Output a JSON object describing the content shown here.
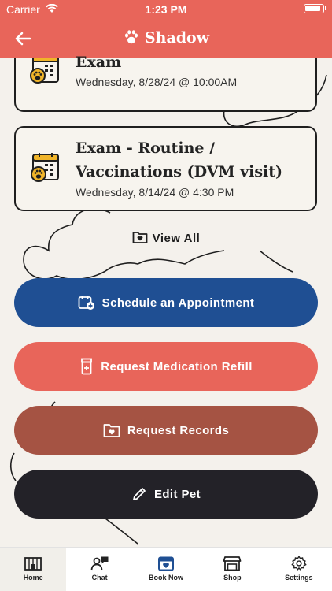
{
  "status_bar": {
    "carrier": "Carrier",
    "time": "1:23 PM"
  },
  "header": {
    "title": "Shadow"
  },
  "appointments": [
    {
      "title": "Exam",
      "date": "Wednesday, 8/28/24 @ 10:00AM"
    },
    {
      "title_line1": "Exam - Routine /",
      "title_line2": "Vaccinations (DVM visit)",
      "date": "Wednesday, 8/14/24 @ 4:30 PM"
    }
  ],
  "view_all_label": "View All",
  "actions": {
    "schedule": "Schedule an Appointment",
    "refill": "Request Medication Refill",
    "records": "Request Records",
    "edit": "Edit Pet"
  },
  "colors": {
    "header": "#e8655a",
    "schedule": "#1f4f93",
    "refill": "#e8655a",
    "records": "#a55343",
    "edit": "#232228",
    "calendar_icon": "#f0b429"
  },
  "tabs": [
    {
      "label": "Home",
      "icon": "home-icon"
    },
    {
      "label": "Chat",
      "icon": "chat-icon"
    },
    {
      "label": "Book Now",
      "icon": "calendar-heart-icon"
    },
    {
      "label": "Shop",
      "icon": "store-icon"
    },
    {
      "label": "Settings",
      "icon": "gear-icon"
    }
  ]
}
